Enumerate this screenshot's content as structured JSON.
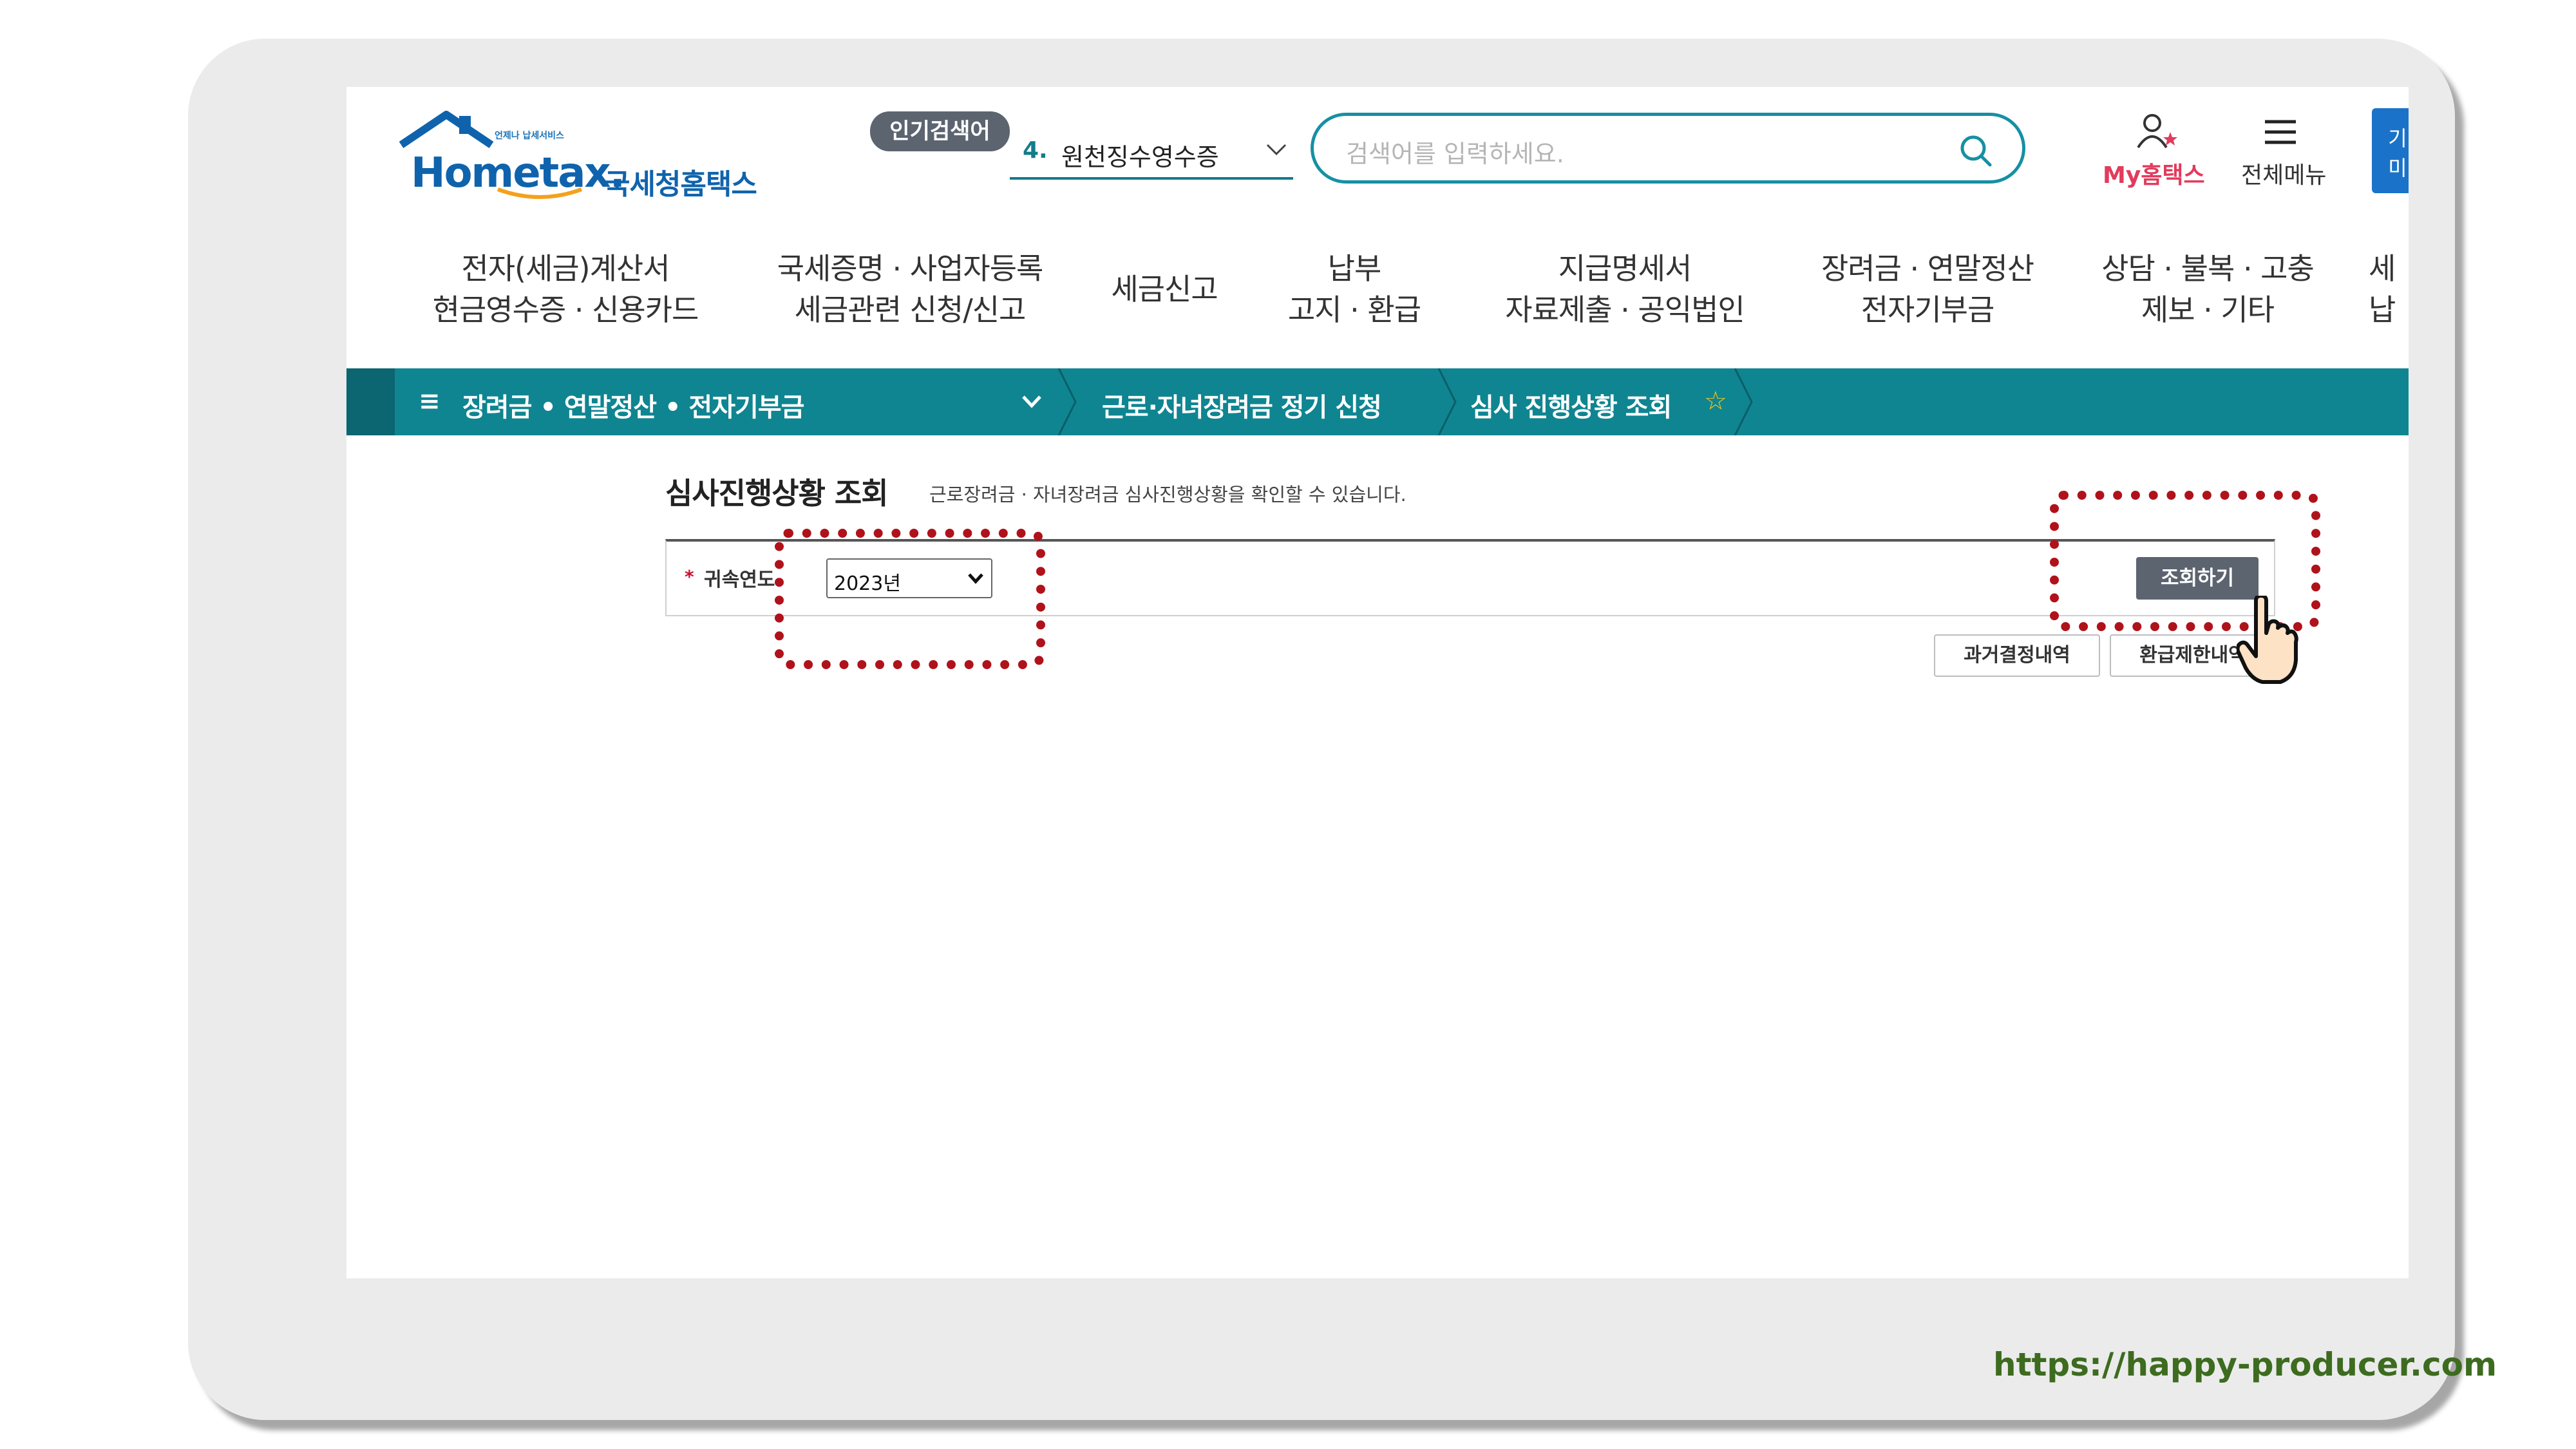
{
  "footer": {
    "url": "https://happy-producer.com"
  },
  "header": {
    "logo_sub": "언제나 납세서비스",
    "logo_main": "Hometax.",
    "logo_kr": "국세청홈택스",
    "popular_badge": "인기검색어",
    "popular_item_num": "4.",
    "popular_item_text": "원천징수영수증",
    "search_placeholder": "검색어를 입력하세요.",
    "my_label": "My홈택스",
    "menu_label": "전체메뉴",
    "blue_btn_line1": "기",
    "blue_btn_line2": "미"
  },
  "nav": [
    {
      "line1": "전자(세금)계산서",
      "line2": "현금영수증 · 신용카드"
    },
    {
      "line1": "국세증명 · 사업자등록",
      "line2": "세금관련 신청/신고"
    },
    {
      "line1": "세금신고",
      "line2": ""
    },
    {
      "line1": "납부",
      "line2": "고지 · 환급"
    },
    {
      "line1": "지급명세서",
      "line2": "자료제출 · 공익법인"
    },
    {
      "line1": "장려금 · 연말정산",
      "line2": "전자기부금"
    },
    {
      "line1": "상담 · 불복 · 고충",
      "line2": "제보 · 기타"
    },
    {
      "line1": "세",
      "line2": "납"
    }
  ],
  "breadcrumb": {
    "menu_icon_glyph": "≡",
    "category": "장려금 • 연말정산 • 전자기부금",
    "sub": "근로·자녀장려금 정기 신청",
    "current": "심사 진행상황 조회",
    "star_icon_glyph": "☆"
  },
  "content": {
    "title": "심사진행상황 조회",
    "description": "근로장려금 · 자녀장려금 심사진행상황을 확인할 수 있습니다.",
    "required_mark": "*",
    "year_label": "귀속연도",
    "year_value": "2023년",
    "query_button": "조회하기",
    "past_button": "과거결정내역",
    "limit_button": "환급제한내역"
  },
  "colors": {
    "teal": "#0f8591",
    "brand_blue": "#0f63ad",
    "highlight_red": "#b0121b",
    "footer_green": "#3d6b1f"
  }
}
